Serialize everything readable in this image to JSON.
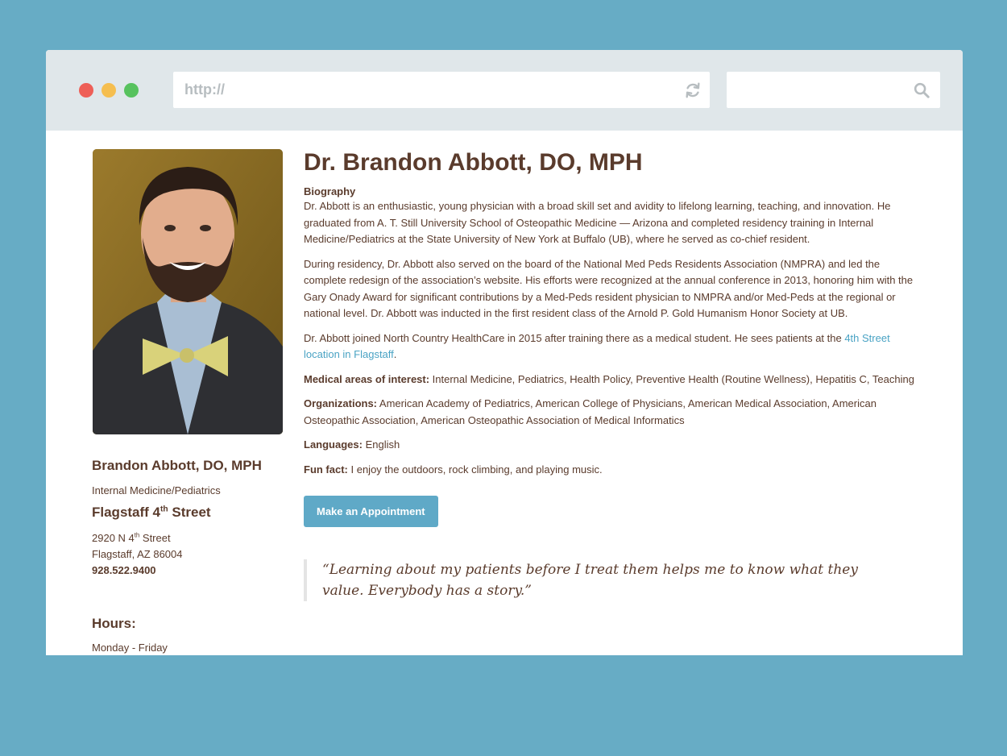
{
  "browser": {
    "url": "http://",
    "search_value": ""
  },
  "doctor": {
    "title": "Dr. Brandon Abbott, DO, MPH",
    "bio_heading": "Biography",
    "bio_p1": "Dr. Abbott is an enthusiastic, young physician with a broad skill set and avidity to lifelong learning, teaching, and innovation. He graduated from A. T. Still University School of Osteopathic Medicine — Arizona and completed residency training in Internal Medicine/Pediatrics at the State University of New York at Buffalo (UB), where he served as co-chief resident.",
    "bio_p2": "During residency, Dr. Abbott also served on the board of the National Med Peds Residents Association (NMPRA) and led the complete redesign of the association’s website. His efforts were recognized at the annual conference in 2013, honoring him with the Gary Onady Award for significant contributions by a Med-Peds resident physician to NMPRA and/or Med-Peds at the regional or national level. Dr. Abbott was inducted in the first resident class of the Arnold P. Gold Humanism Honor Society at UB.",
    "bio_p3_text": "Dr. Abbott joined North Country HealthCare in 2015 after training there as a medical student. He sees patients at the ",
    "bio_p3_link": "4th Street location in Flagstaff",
    "bio_p3_end": ".",
    "interest_label": "Medical areas of interest:",
    "interest_value": " Internal Medicine, Pediatrics, Health Policy, Preventive Health (Routine Wellness), Hepatitis C, Teaching",
    "org_label": "Organizations:",
    "org_value": " American Academy of Pediatrics, American College of Physicians, American Medical Association, American Osteopathic Association, American Osteopathic Association of Medical Informatics",
    "lang_label": "Languages:",
    "lang_value": " English",
    "fun_label": "Fun fact:",
    "fun_value": " I enjoy the outdoors, rock climbing, and playing music.",
    "appointment_button": "Make an Appointment",
    "quote": "“Learning about my patients before I treat them helps me to know what they value. Everybody has a story.”"
  },
  "sidebar": {
    "name": "Brandon Abbott, DO, MPH",
    "specialty": "Internal Medicine/Pediatrics",
    "location_prefix": "Flagstaff 4",
    "location_sup": "th",
    "location_suffix": " Street",
    "address_prefix": "2920 N 4",
    "address_sup": "th",
    "address_suffix": " Street",
    "city": "Flagstaff, AZ 86004",
    "phone": "928.522.9400",
    "hours_title": "Hours:",
    "hours_days": "Monday - Friday"
  },
  "colors": {
    "background": "#67acc5",
    "text": "#5a3b2c",
    "link": "#4aa3c4",
    "button": "#5fa9c7"
  },
  "icons": {
    "reload": "reload-icon",
    "search": "search-icon"
  }
}
